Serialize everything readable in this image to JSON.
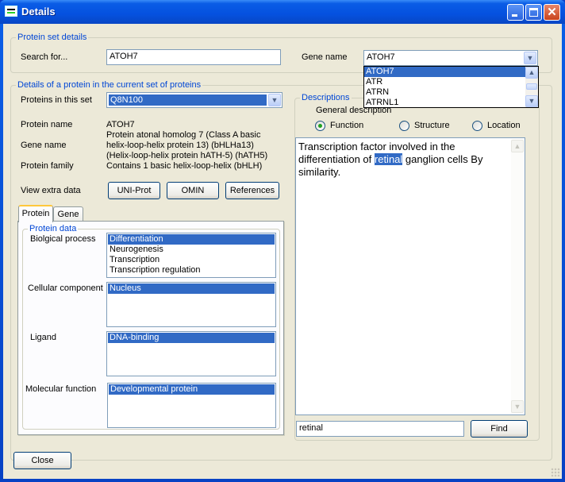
{
  "window": {
    "title": "Details",
    "minimize_label": "_",
    "maximize_label": "□",
    "close_label": "✕"
  },
  "protein_set": {
    "legend": "Protein set details",
    "search_label": "Search for...",
    "search_value": "ATOH7",
    "gene_name_label": "Gene name",
    "gene_name_value": "ATOH7",
    "gene_dropdown_options": [
      "ATOH7",
      "ATR",
      "ATRN",
      "ATRNL1"
    ],
    "gene_dropdown_selected": "ATOH7"
  },
  "protein_details": {
    "legend": "Details of a protein in the current set of proteins",
    "proteins_label": "Proteins in this set",
    "proteins_value": "Q8N100",
    "protein_name_label": "Protein name",
    "protein_name_value": "ATOH7",
    "protein_desc_lines": [
      "Protein atonal homolog 7 (Class A basic",
      "helix-loop-helix protein 13) (bHLHa13)",
      "(Helix-loop-helix protein hATH-5) (hATH5)"
    ],
    "gene_name_label": "Gene name",
    "protein_family_label": "Protein family",
    "protein_family_value": "Contains 1 basic helix-loop-helix (bHLH)",
    "extra_data_label": "View extra data",
    "buttons": {
      "uniprot": "UNI-Prot",
      "omin": "OMIN",
      "references": "References"
    }
  },
  "tabs": [
    {
      "label": "Protein",
      "active": true
    },
    {
      "label": "Gene",
      "active": false
    }
  ],
  "protein_data": {
    "legend": "Protein data",
    "biological_process": {
      "label": "Biolgical process",
      "items": [
        "Differentiation",
        "Neurogenesis",
        "Transcription",
        "Transcription regulation"
      ]
    },
    "cellular_component": {
      "label": "Cellular component",
      "items": [
        "Nucleus"
      ]
    },
    "ligand": {
      "label": "Ligand",
      "items": [
        "DNA-binding"
      ]
    },
    "molecular_function": {
      "label": "Molecular function",
      "items": [
        "Developmental protein"
      ]
    }
  },
  "descriptions": {
    "legend": "Descriptions",
    "general_label": "General description",
    "radios": [
      {
        "label": "Function",
        "checked": true
      },
      {
        "label": "Structure",
        "checked": false
      },
      {
        "label": "Location",
        "checked": false
      }
    ],
    "text_before": "Transcription factor involved in the differentiation of ",
    "text_highlight": "retinal",
    "text_after": " ganglion cells  By similarity.",
    "find_value": "retinal",
    "find_button": "Find"
  },
  "footer": {
    "close_button": "Close"
  },
  "icons": {
    "scroll_up": "▲",
    "scroll_down": "▼",
    "combo_arrow": "▼"
  }
}
